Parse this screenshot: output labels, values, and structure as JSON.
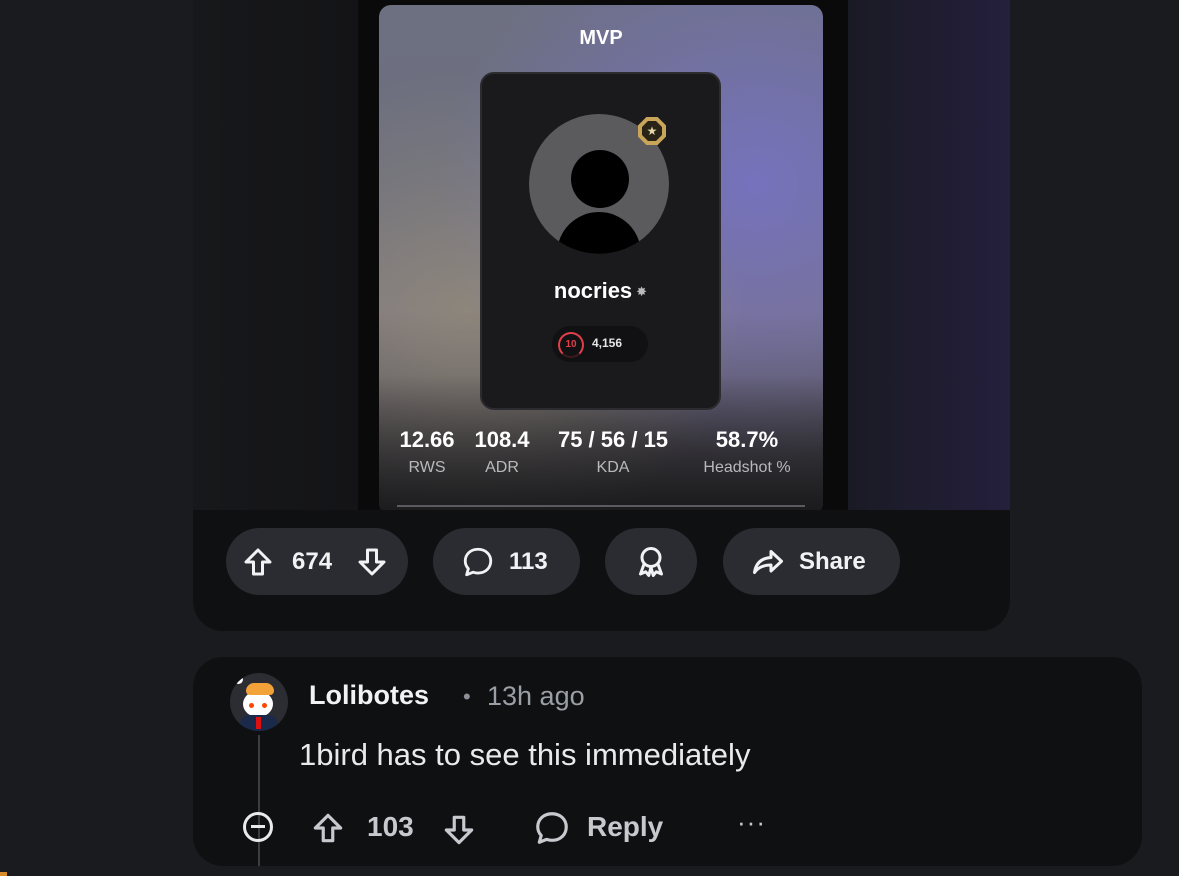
{
  "post": {
    "media": {
      "mvp_title": "MVP",
      "player_name": "nocries",
      "skill_level": "10",
      "elo": "4,156",
      "stats": [
        {
          "value": "12.66",
          "label": "RWS"
        },
        {
          "value": "108.4",
          "label": "ADR"
        },
        {
          "value": "75 / 56 / 15",
          "label": "KDA"
        },
        {
          "value": "58.7%",
          "label": "Headshot %"
        }
      ]
    },
    "actions": {
      "upvotes": "674",
      "comments": "113",
      "share_label": "Share"
    }
  },
  "comment": {
    "author": "Lolibotes",
    "separator": "•",
    "time": "13h ago",
    "body": "1bird has to see this immediately",
    "votes": "103",
    "reply_label": "Reply",
    "more": "···"
  },
  "colors": {
    "background": "#1a1b1f",
    "card": "#0f1012",
    "pill": "#2a2c31",
    "elo_red": "#e0404a"
  }
}
